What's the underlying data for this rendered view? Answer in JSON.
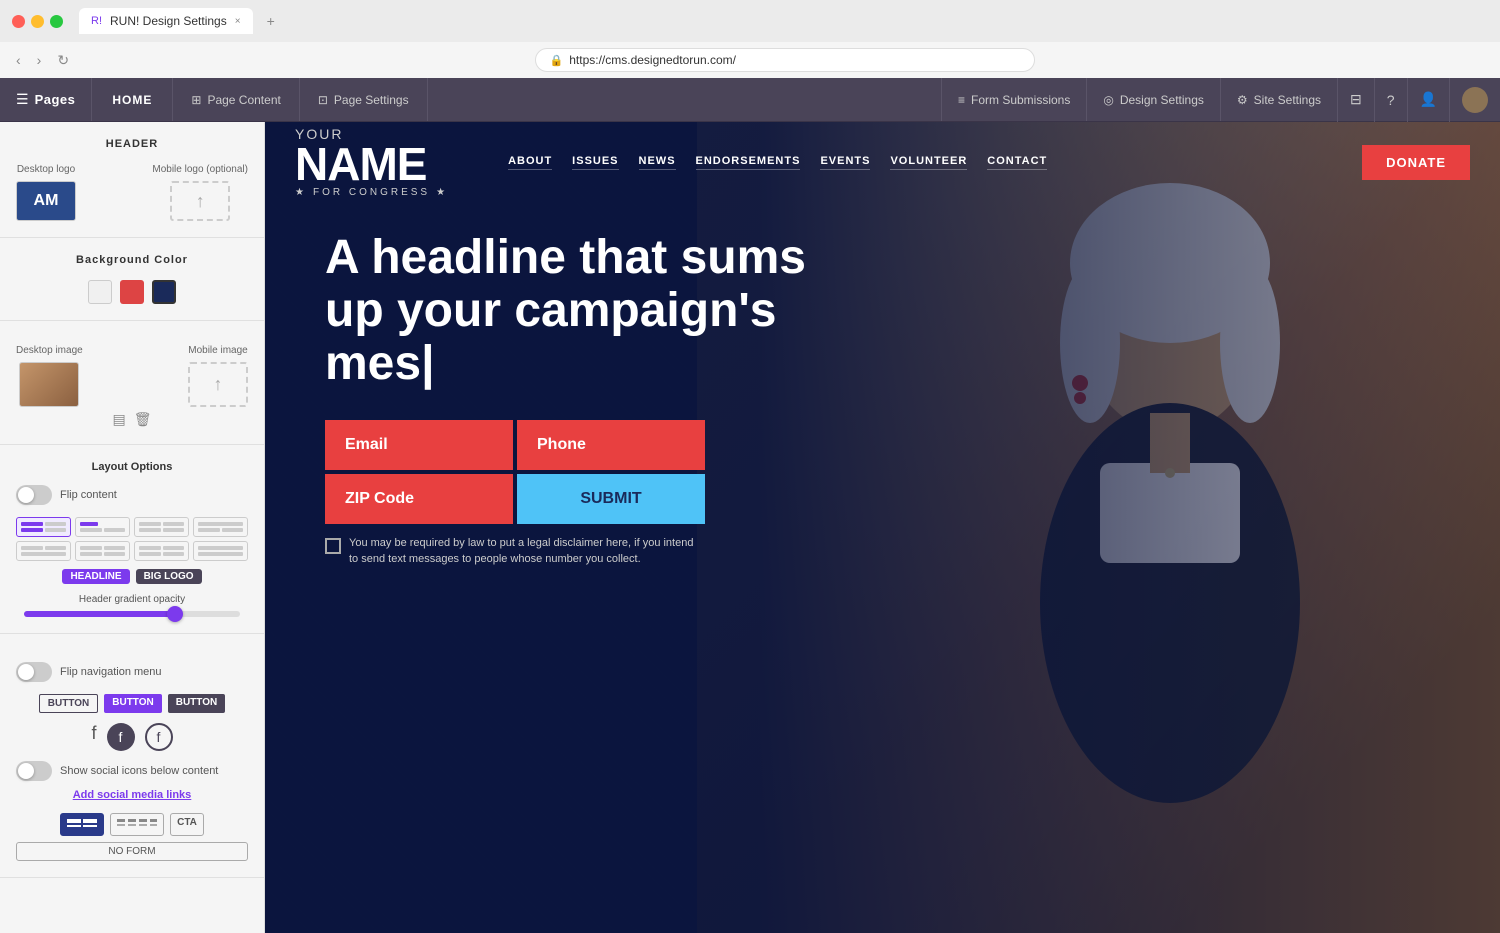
{
  "browser": {
    "traffic_lights": [
      "red",
      "yellow",
      "green"
    ],
    "tab_label": "RUN! Design Settings",
    "tab_close": "×",
    "tab_plus": "+",
    "url": "https://cms.designedtorun.com/"
  },
  "app_header": {
    "hamburger": "☰",
    "pages_label": "Pages",
    "home_btn": "HOME",
    "tabs": [
      {
        "id": "page-content",
        "icon": "⊞",
        "label": "Page Content",
        "active": false
      },
      {
        "id": "page-settings",
        "icon": "⊡",
        "label": "Page Settings",
        "active": false
      }
    ],
    "right_btns": [
      {
        "id": "form-submissions",
        "icon": "≡",
        "label": "Form Submissions"
      },
      {
        "id": "design-settings",
        "icon": "⊙",
        "label": "Design Settings"
      },
      {
        "id": "site-settings",
        "icon": "⚙",
        "label": "Site Settings"
      }
    ],
    "icon_btns": [
      "⊟",
      "?",
      "👤"
    ]
  },
  "sidebar": {
    "header_section_title": "HEADER",
    "desktop_logo_label": "Desktop logo",
    "mobile_logo_label": "Mobile logo (optional)",
    "logo_text": "AM",
    "bg_color_title": "Background Color",
    "colors": [
      {
        "id": "white",
        "class": "color-white",
        "active": false
      },
      {
        "id": "red",
        "class": "color-red",
        "active": false
      },
      {
        "id": "navy",
        "class": "color-navy",
        "active": true
      }
    ],
    "desktop_image_label": "Desktop image",
    "mobile_image_label": "Mobile image",
    "layout_options_title": "Layout Options",
    "flip_content_label": "Flip content",
    "flip_content_on": false,
    "layout_options": [
      {
        "id": "opt1",
        "active": true
      },
      {
        "id": "opt2",
        "active": false
      },
      {
        "id": "opt3",
        "active": false
      },
      {
        "id": "opt4",
        "active": false
      },
      {
        "id": "opt5",
        "active": false
      },
      {
        "id": "opt6",
        "active": false
      },
      {
        "id": "opt7",
        "active": false
      },
      {
        "id": "opt8",
        "active": false
      }
    ],
    "style_tags": [
      {
        "id": "headline",
        "label": "HEADLINE",
        "active": true
      },
      {
        "id": "biglogo",
        "label": "BIG LOGO",
        "active": true
      }
    ],
    "gradient_label": "Header gradient opacity",
    "slider_pct": 70,
    "flip_nav_label": "Flip navigation menu",
    "flip_nav_on": false,
    "button_styles": [
      {
        "id": "outline",
        "label": "BUTTON",
        "style": "outline"
      },
      {
        "id": "purple",
        "label": "BUTTON",
        "style": "filled"
      },
      {
        "id": "dark",
        "label": "BUTTON",
        "style": "dark"
      }
    ],
    "social_icons": [
      "f",
      "f",
      "f"
    ],
    "show_social_label": "Show social icons below content",
    "show_social_on": false,
    "add_social_link": "Add social media links",
    "bottom_options": [
      {
        "id": "blue-bar",
        "label": "▬▬",
        "active": true
      },
      {
        "id": "grey-bars",
        "label": "▬▬▬▬",
        "active": false
      },
      {
        "id": "cta",
        "label": "CTA",
        "active": false
      }
    ],
    "no_form_btn": "NO FORM"
  },
  "preview": {
    "logo": {
      "your": "YOUR",
      "name": "NAME",
      "congress": "FOR CONGRESS"
    },
    "nav_items": [
      "ABOUT",
      "ISSUES",
      "NEWS",
      "ENDORSEMENTS",
      "EVENTS",
      "VOLUNTEER",
      "CONTACT"
    ],
    "donate_btn": "DONATE",
    "headline": "A headline that sums up your campaign's mes|",
    "form_fields": [
      {
        "id": "email",
        "label": "Email",
        "type": "email"
      },
      {
        "id": "phone",
        "label": "Phone",
        "type": "phone"
      },
      {
        "id": "zip",
        "label": "ZIP Code",
        "type": "zip"
      },
      {
        "id": "submit",
        "label": "SUBMIT",
        "type": "submit"
      }
    ],
    "disclaimer": "You may be required by law to put a legal disclaimer here, if you intend to send text messages to people whose number you collect."
  }
}
